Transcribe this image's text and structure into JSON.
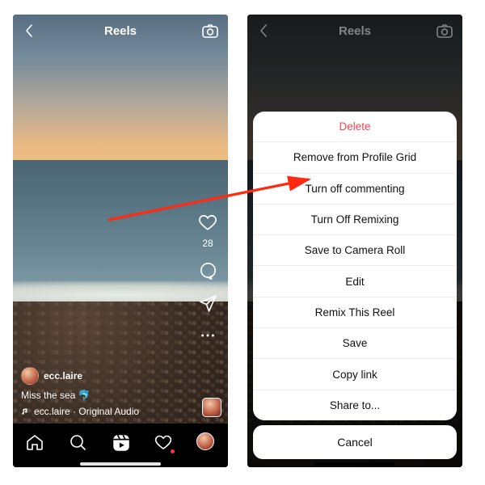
{
  "header": {
    "title": "Reels"
  },
  "reel": {
    "username": "ecc.laire",
    "caption": "Miss the sea 🐬",
    "audio_line": "ecc.laire · Original Audio",
    "like_count": "28"
  },
  "icons": {
    "back": "chevron-left-icon",
    "camera": "camera-icon",
    "like": "heart-icon",
    "comment": "comment-icon",
    "share": "paperplane-icon",
    "more": "more-icon",
    "music": "music-note-icon",
    "home": "home-icon",
    "search": "search-icon",
    "reels_tab": "reels-icon",
    "activity": "heart-outline-icon",
    "profile": "avatar-icon"
  },
  "action_sheet": {
    "options": [
      {
        "label": "Delete",
        "destructive": true
      },
      {
        "label": "Remove from Profile Grid"
      },
      {
        "label": "Turn off commenting"
      },
      {
        "label": "Turn Off Remixing"
      },
      {
        "label": "Save to Camera Roll"
      },
      {
        "label": "Edit"
      },
      {
        "label": "Remix This Reel"
      },
      {
        "label": "Save"
      },
      {
        "label": "Copy link"
      },
      {
        "label": "Share to..."
      }
    ],
    "cancel_label": "Cancel"
  },
  "annotation": {
    "arrow_color": "#ff2a12"
  }
}
